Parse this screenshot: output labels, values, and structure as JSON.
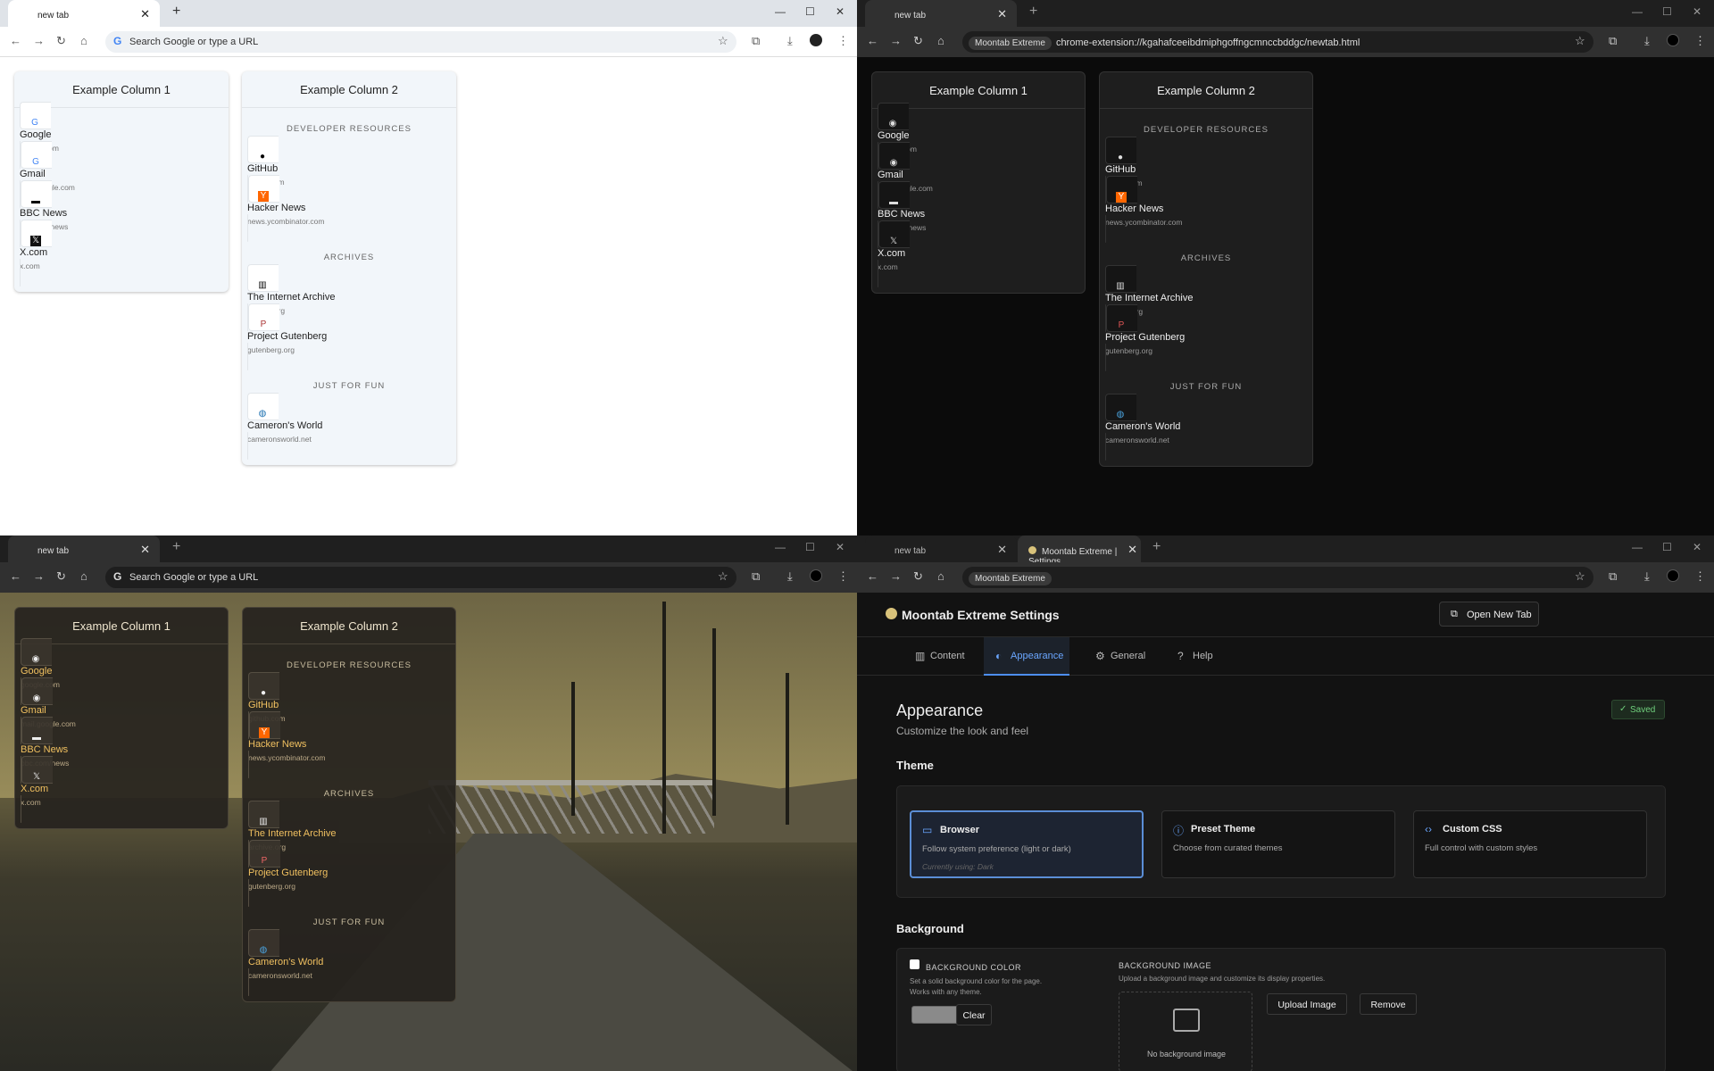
{
  "browser": {
    "tab_title": "new tab",
    "omnibox_placeholder": "Search Google or type a URL",
    "extension_chip": "Moontab Extreme",
    "extension_url": "chrome-extension://kgahafceeibdmiphgoffngcmnccbddgc/newtab.html",
    "settings_tab_title": "Moontab Extreme | Settings"
  },
  "columns": [
    {
      "title": "Example Column 1",
      "sections": [
        {
          "heading": "",
          "links": [
            {
              "name": "Google",
              "domain": "google.com",
              "icon": "google-icon"
            },
            {
              "name": "Gmail",
              "domain": "mail.google.com",
              "icon": "google-icon"
            },
            {
              "name": "BBC News",
              "domain": "bbc.com/news",
              "icon": "bbc-icon"
            },
            {
              "name": "X.com",
              "domain": "x.com",
              "icon": "x-icon"
            }
          ]
        }
      ]
    },
    {
      "title": "Example Column 2",
      "sections": [
        {
          "heading": "DEVELOPER RESOURCES",
          "links": [
            {
              "name": "GitHub",
              "domain": "github.com",
              "icon": "github-icon"
            },
            {
              "name": "Hacker News",
              "domain": "news.ycombinator.com",
              "icon": "hackernews-icon"
            }
          ]
        },
        {
          "heading": "ARCHIVES",
          "links": [
            {
              "name": "The Internet Archive",
              "domain": "archive.org",
              "icon": "archive-icon"
            },
            {
              "name": "Project Gutenberg",
              "domain": "gutenberg.org",
              "icon": "gutenberg-icon"
            }
          ]
        },
        {
          "heading": "JUST FOR FUN",
          "links": [
            {
              "name": "Cameron's World",
              "domain": "cameronsworld.net",
              "icon": "globe-icon"
            }
          ]
        }
      ]
    }
  ],
  "settings": {
    "title": "Moontab Extreme Settings",
    "open_new_tab": "Open New Tab",
    "tabs": [
      "Content",
      "Appearance",
      "General",
      "Help"
    ],
    "active_tab": "Appearance",
    "heading": "Appearance",
    "subheading": "Customize the look and feel",
    "saved": "Saved",
    "theme_heading": "Theme",
    "theme_options": [
      {
        "name": "Browser",
        "desc": "Follow system preference (light or dark)",
        "note": "Currently using: Dark"
      },
      {
        "name": "Preset Theme",
        "desc": "Choose from curated themes"
      },
      {
        "name": "Custom CSS",
        "desc": "Full control with custom styles"
      }
    ],
    "background_heading": "Background",
    "bg_color_label": "BACKGROUND COLOR",
    "bg_color_desc": "Set a solid background color for the page. Works with any theme.",
    "clear": "Clear",
    "bg_image_label": "BACKGROUND IMAGE",
    "bg_image_desc": "Upload a background image and customize its display properties.",
    "upload": "Upload Image",
    "remove": "Remove",
    "no_image": "No background image"
  },
  "colors": {
    "accent": "#4d8ef0",
    "saved_green": "#6fcf7c",
    "link_gold": "#f0c060"
  }
}
